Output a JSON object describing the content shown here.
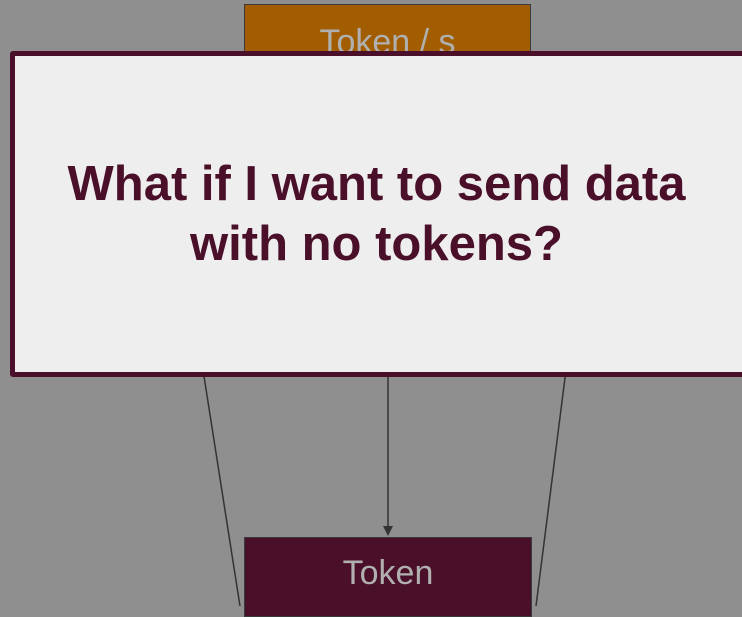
{
  "diagram": {
    "top_node": {
      "label": "Token / s",
      "color": "#a25d00"
    },
    "bottom_node": {
      "label": "Token",
      "color": "#4a0f29"
    }
  },
  "callout": {
    "text": "What if I want to send data with no tokens?",
    "text_color": "#4a0f29",
    "background": "#eeeeee",
    "border_color": "#4a0f29"
  },
  "colors": {
    "canvas_background": "#8f8f8f",
    "connector": "#333333"
  }
}
